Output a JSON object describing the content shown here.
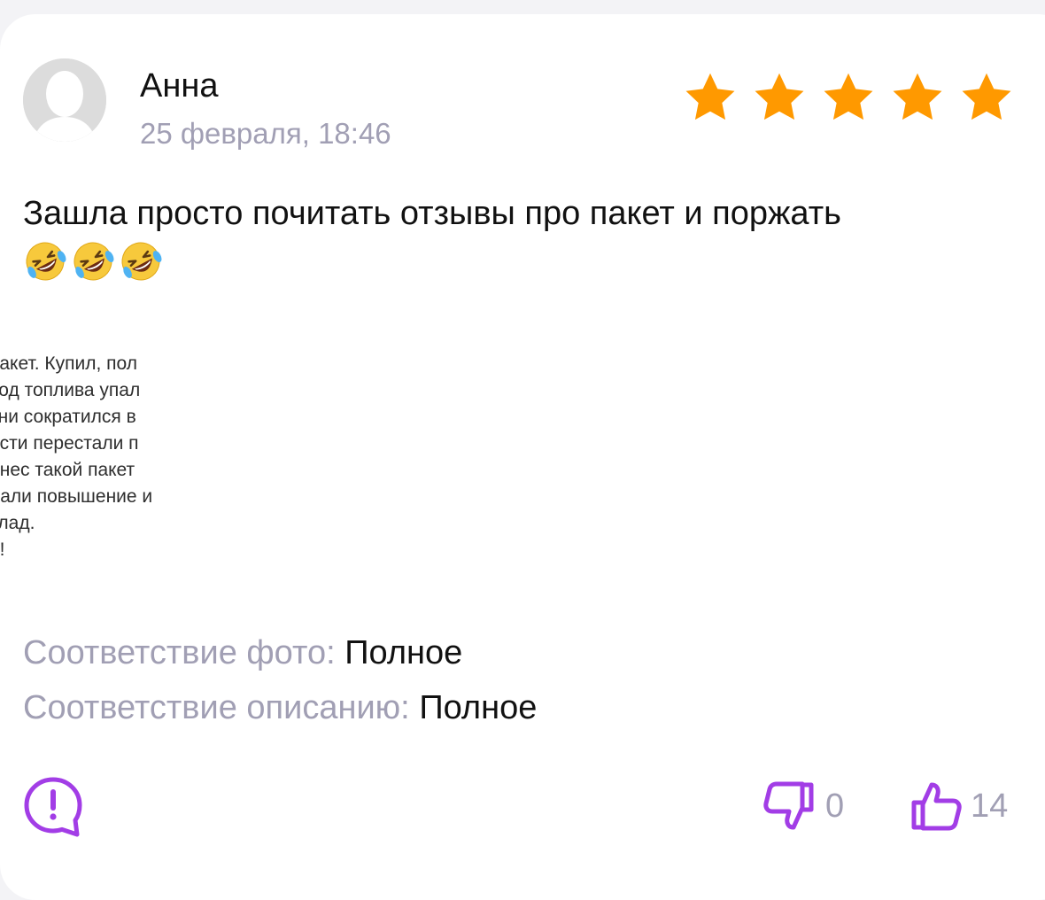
{
  "review": {
    "author": "Анна",
    "date": "25 февраля, 18:46",
    "rating": 5,
    "rating_max": 5,
    "text": "Зашла просто почитать отзывы про пакет и поржать",
    "emoji": [
      "rolling-on-floor-laughing",
      "rolling-on-floor-laughing",
      "rolling-on-floor-laughing"
    ],
    "photo_text_lines": [
      "пакет. Купил, пол",
      "ход топлива упал",
      "тни сократился в",
      "ости перестали п",
      "инес такой пакет",
      "дали повышение и",
      "клад.",
      "о!"
    ],
    "photo_match": {
      "label": "Соответствие фото:",
      "value": "Полное"
    },
    "description_match": {
      "label": "Соответствие описанию:",
      "value": "Полное"
    },
    "dislikes": "0",
    "likes": "14"
  },
  "colors": {
    "star": "#ff9900",
    "accent": "#a23de6",
    "muted": "#a19fb4",
    "text": "#111111"
  },
  "icons": {
    "complain": "exclamation-bubble-icon",
    "dislike": "thumbs-down-icon",
    "like": "thumbs-up-icon"
  }
}
